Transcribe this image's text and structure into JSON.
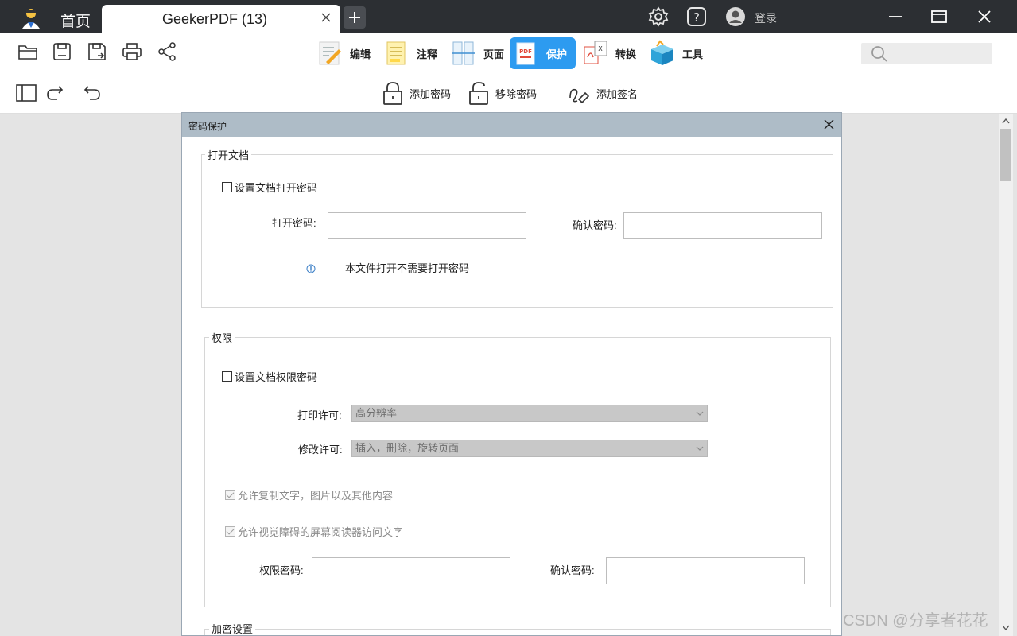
{
  "titlebar": {
    "home_tab": "首页",
    "doc_tab_title": "GeekerPDF (13)",
    "login_label": "登录",
    "icons": [
      "app-logo",
      "close-icon",
      "plus-icon",
      "gear-icon",
      "help-icon",
      "user-avatar-icon",
      "minimize-icon",
      "maximize-icon",
      "close-icon"
    ]
  },
  "toolbar": {
    "ribbon": [
      {
        "label": "编辑",
        "icon": "edit-icon",
        "active": false
      },
      {
        "label": "注释",
        "icon": "annotate-icon",
        "active": false
      },
      {
        "label": "页面",
        "icon": "page-icon",
        "active": false
      },
      {
        "label": "保护",
        "icon": "protect-icon",
        "active": true
      },
      {
        "label": "转换",
        "icon": "convert-icon",
        "active": false
      },
      {
        "label": "工具",
        "icon": "tools-icon",
        "active": false
      }
    ],
    "file_icons": [
      "open-folder-icon",
      "save-icon",
      "save-as-icon",
      "print-icon",
      "share-icon"
    ],
    "search_placeholder": "",
    "active_color": "#2d9bf0"
  },
  "subbar": {
    "nav_icons": [
      "sidebar-icon",
      "redo-icon",
      "undo-icon"
    ],
    "actions": [
      {
        "label": "添加密码",
        "icon": "lock-icon"
      },
      {
        "label": "移除密码",
        "icon": "unlock-icon"
      },
      {
        "label": "添加签名",
        "icon": "signature-icon"
      }
    ]
  },
  "dialog": {
    "title": "密码保护",
    "open_doc": {
      "group_title": "打开文档",
      "checkbox_label": "设置文档打开密码",
      "checked": false,
      "open_password_label": "打开密码:",
      "confirm_password_label": "确认密码:",
      "open_password_value": "",
      "confirm_password_value": "",
      "info_text": "本文件打开不需要打开密码"
    },
    "permissions": {
      "group_title": "权限",
      "checkbox_label": "设置文档权限密码",
      "checked": false,
      "print_label": "打印许可:",
      "print_value": "高分辨率",
      "modify_label": "修改许可:",
      "modify_value": "插入，删除，旋转页面",
      "allow_copy_label": "允许复制文字，图片以及其他内容",
      "allow_copy_checked": true,
      "allow_reader_label": "允许视觉障碍的屏幕阅读器访问文字",
      "allow_reader_checked": true,
      "perm_password_label": "权限密码:",
      "confirm_password_label": "确认密码:",
      "perm_password_value": "",
      "confirm_password_value": ""
    },
    "encryption": {
      "group_title": "加密设置"
    }
  },
  "watermark": "CSDN @分享者花花"
}
